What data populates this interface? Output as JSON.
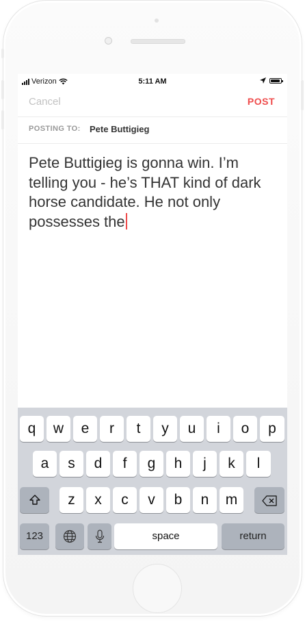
{
  "status_bar": {
    "carrier": "Verizon",
    "time": "5:11 AM"
  },
  "nav": {
    "cancel_label": "Cancel",
    "post_label": "POST"
  },
  "posting": {
    "label": "POSTING TO:",
    "recipient": "Pete Buttigieg"
  },
  "editor": {
    "text": "Pete Buttigieg is gonna win. I’m\ntelling you - he’s THAT kind of dark\nhorse candidate. He not only\npossesses the"
  },
  "keyboard": {
    "row1": [
      "q",
      "w",
      "e",
      "r",
      "t",
      "y",
      "u",
      "i",
      "o",
      "p"
    ],
    "row2": [
      "a",
      "s",
      "d",
      "f",
      "g",
      "h",
      "j",
      "k",
      "l"
    ],
    "row3": [
      "z",
      "x",
      "c",
      "v",
      "b",
      "n",
      "m"
    ],
    "numbers_label": "123",
    "space_label": "space",
    "return_label": "return"
  },
  "colors": {
    "accent": "#ef4b4b",
    "keyboard_bg": "#d2d5db",
    "dark_key": "#adb3bc"
  },
  "icons": [
    "signal-icon",
    "wifi-icon",
    "location-icon",
    "battery-icon",
    "shift-icon",
    "backspace-icon",
    "globe-icon",
    "microphone-icon"
  ]
}
